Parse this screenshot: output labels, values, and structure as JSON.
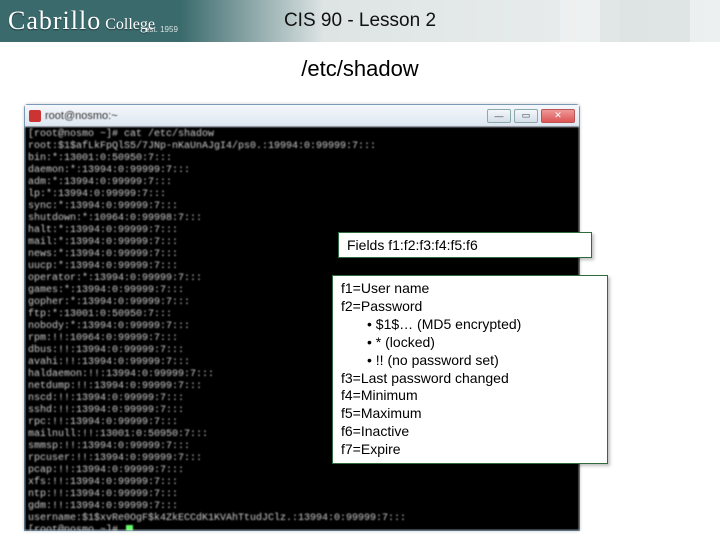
{
  "header": {
    "logo_main": "Cabrillo",
    "logo_sub": "College",
    "logo_est": "est. 1959",
    "title": "CIS 90 - Lesson 2"
  },
  "subtitle": "/etc/shadow",
  "terminal": {
    "chrome_title": "root@nosmo:~",
    "lines": [
      "[root@nosmo ~]# cat /etc/shadow",
      "root:$1$afLkFpQlS5/7JNp-nKaUnAJgI4/ps0.:19994:0:99999:7:::",
      "bin:*:13001:0:50950:7:::",
      "daemon:*:13994:0:99999:7:::",
      "adm:*:13994:0:99999:7:::",
      "lp:*:13994:0:99999:7:::",
      "sync:*:13994:0:99999:7:::",
      "shutdown:*:10964:0:99998:7:::",
      "halt:*:13994:0:99999:7:::",
      "mail:*:13994:0:99999:7:::",
      "news:*:13994:0:99999:7:::",
      "uucp:*:13994:0:99999:7:::",
      "operator:*:13994:0:99999:7:::",
      "games:*:13994:0:99999:7:::",
      "gopher:*:13994:0:99999:7:::",
      "ftp:*:13001:0:50950:7:::",
      "nobody:*:13994:0:99999:7:::",
      "rpm:!!:10964:0:99999:7:::",
      "dbus:!!:13994:0:99999:7:::",
      "avahi:!!:13994:0:99999:7:::",
      "haldaemon:!!:13994:0:99999:7:::",
      "netdump:!!:13994:0:99999:7:::",
      "nscd:!!:13994:0:99999:7:::",
      "sshd:!!:13994:0:99999:7:::",
      "rpc:!!:13994:0:99999:7:::",
      "mailnull:!!:13001:0:50950:7:::",
      "smmsp:!!:13994:0:99999:7:::",
      "rpcuser:!!:13994:0:99999:7:::",
      "pcap:!!:13994:0:99999:7:::",
      "xfs:!!:13994:0:99999:7:::",
      "ntp:!!:13994:0:99999:7:::",
      "gdm:!!:13994:0:99999:7:::",
      "username:$1$xvRe0OgF$k4ZkECCdK1KVAhTtudJClz.:13994:0:99999:7:::",
      "[root@nosmo ~]# "
    ]
  },
  "fields_box": "Fields f1:f2:f3:f4:f5:f6",
  "legend": {
    "f1": "f1=User name",
    "f2": "f2=Password",
    "b1": "$1$… (MD5 encrypted)",
    "b2": "* (locked)",
    "b3": "!! (no password set)",
    "f3": "f3=Last password changed",
    "f4": "f4=Minimum",
    "f5": "f5=Maximum",
    "f6": "f6=Inactive",
    "f7": "f7=Expire"
  }
}
